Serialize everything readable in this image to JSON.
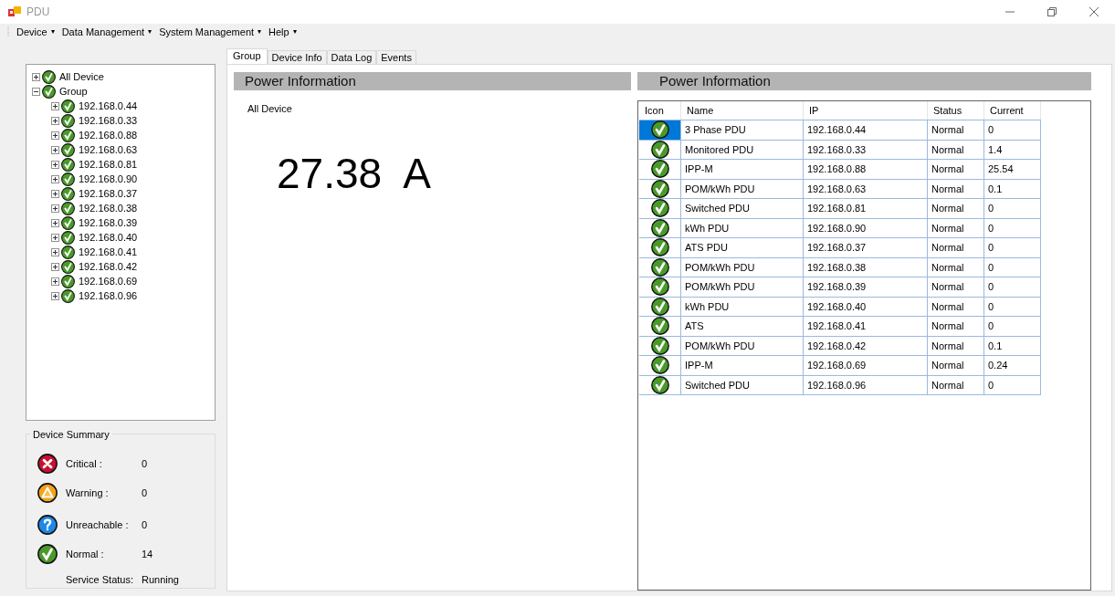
{
  "window": {
    "title": "PDU"
  },
  "menu": [
    {
      "label": "Device",
      "arrow": "▾"
    },
    {
      "label": "Data Management",
      "arrow": "▾"
    },
    {
      "label": "System Management",
      "arrow": "▾"
    },
    {
      "label": "Help",
      "arrow": "▾"
    }
  ],
  "tree": [
    {
      "label": "All Device",
      "kind": "normal",
      "expanded": false
    },
    {
      "label": "Group",
      "kind": "normal",
      "expanded": true,
      "children": [
        {
          "label": "192.168.0.44",
          "kind": "normal",
          "expanded": false
        },
        {
          "label": "192.168.0.33",
          "kind": "normal",
          "expanded": false
        },
        {
          "label": "192.168.0.88",
          "kind": "normal",
          "expanded": false
        },
        {
          "label": "192.168.0.63",
          "kind": "normal",
          "expanded": false
        },
        {
          "label": "192.168.0.81",
          "kind": "normal",
          "expanded": false
        },
        {
          "label": "192.168.0.90",
          "kind": "normal",
          "expanded": false
        },
        {
          "label": "192.168.0.37",
          "kind": "normal",
          "expanded": false
        },
        {
          "label": "192.168.0.38",
          "kind": "normal",
          "expanded": false
        },
        {
          "label": "192.168.0.39",
          "kind": "normal",
          "expanded": false
        },
        {
          "label": "192.168.0.40",
          "kind": "normal",
          "expanded": false
        },
        {
          "label": "192.168.0.41",
          "kind": "normal",
          "expanded": false
        },
        {
          "label": "192.168.0.42",
          "kind": "normal",
          "expanded": false
        },
        {
          "label": "192.168.0.69",
          "kind": "normal",
          "expanded": false
        },
        {
          "label": "192.168.0.96",
          "kind": "normal",
          "expanded": false
        }
      ]
    }
  ],
  "summary": {
    "title": "Device Summary",
    "items": [
      {
        "kind": "critical",
        "label": "Critical :",
        "value": "0"
      },
      {
        "kind": "warning",
        "label": "Warning :",
        "value": "0"
      },
      {
        "kind": "unreachable",
        "label": "Unreachable :",
        "value": "0"
      },
      {
        "kind": "normal",
        "label": "Normal :",
        "value": "14"
      }
    ],
    "service_label": "Service Status:",
    "service_value": "Running"
  },
  "tabs": [
    {
      "label": "Group",
      "selected": true
    },
    {
      "label": "Device Info",
      "selected": false
    },
    {
      "label": "Data Log",
      "selected": false
    },
    {
      "label": "Events",
      "selected": false
    }
  ],
  "left_panel": {
    "title": "Power Information",
    "scope": "All Device",
    "total": "27.38  A"
  },
  "right_panel": {
    "title": "Power Information",
    "columns": [
      "Icon",
      "Name",
      "IP",
      "Status",
      "Current"
    ],
    "rows": [
      {
        "kind": "normal",
        "selected": true,
        "name": "3 Phase PDU",
        "ip": "192.168.0.44",
        "status_text": "Normal",
        "current": "0"
      },
      {
        "kind": "normal",
        "selected": false,
        "name": "Monitored PDU",
        "ip": "192.168.0.33",
        "status_text": "Normal",
        "current": "1.4"
      },
      {
        "kind": "normal",
        "selected": false,
        "name": "IPP-M",
        "ip": "192.168.0.88",
        "status_text": "Normal",
        "current": "25.54"
      },
      {
        "kind": "normal",
        "selected": false,
        "name": "POM/kWh PDU",
        "ip": "192.168.0.63",
        "status_text": "Normal",
        "current": "0.1"
      },
      {
        "kind": "normal",
        "selected": false,
        "name": "Switched PDU",
        "ip": "192.168.0.81",
        "status_text": "Normal",
        "current": "0"
      },
      {
        "kind": "normal",
        "selected": false,
        "name": "kWh PDU",
        "ip": "192.168.0.90",
        "status_text": "Normal",
        "current": "0"
      },
      {
        "kind": "normal",
        "selected": false,
        "name": "ATS PDU",
        "ip": "192.168.0.37",
        "status_text": "Normal",
        "current": "0"
      },
      {
        "kind": "normal",
        "selected": false,
        "name": "POM/kWh PDU",
        "ip": "192.168.0.38",
        "status_text": "Normal",
        "current": "0"
      },
      {
        "kind": "normal",
        "selected": false,
        "name": "POM/kWh PDU",
        "ip": "192.168.0.39",
        "status_text": "Normal",
        "current": "0"
      },
      {
        "kind": "normal",
        "selected": false,
        "name": "kWh PDU",
        "ip": "192.168.0.40",
        "status_text": "Normal",
        "current": "0"
      },
      {
        "kind": "normal",
        "selected": false,
        "name": "ATS",
        "ip": "192.168.0.41",
        "status_text": "Normal",
        "current": "0"
      },
      {
        "kind": "normal",
        "selected": false,
        "name": "POM/kWh PDU",
        "ip": "192.168.0.42",
        "status_text": "Normal",
        "current": "0.1"
      },
      {
        "kind": "normal",
        "selected": false,
        "name": "IPP-M",
        "ip": "192.168.0.69",
        "status_text": "Normal",
        "current": "0.24"
      },
      {
        "kind": "normal",
        "selected": false,
        "name": "Switched PDU",
        "ip": "192.168.0.96",
        "status_text": "Normal",
        "current": "0"
      }
    ]
  }
}
